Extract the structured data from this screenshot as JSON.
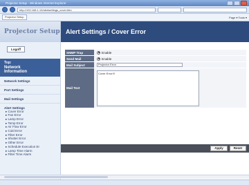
{
  "browser": {
    "title": "Projector Setup - Windows Internet Explorer",
    "address": "http://192.168.1.10/alertsettings_cover.htm",
    "address_go": "",
    "search_placeholder": "",
    "tab_label": "Projector Setup",
    "tools": "Page ▾  Tools ▾"
  },
  "sidebar": {
    "brand": "Projector Setup",
    "logout": "Logoff",
    "top_label": "Top:",
    "top_title_1": "Network",
    "top_title_2": "Information",
    "links": [
      "Network Settings",
      "Port Settings",
      "Mail Settings"
    ],
    "alert_group": "Alert Settings",
    "alert_items": [
      "Cover Error",
      "Fan Error",
      "Lamp Error",
      "Temp Error",
      "Air Flow Error",
      "Cold Error",
      "Filter Error",
      "Shutter Error",
      "Other Error",
      "Schedule Execution Er",
      "Lamp Time Alarm",
      "Filter Time Alarm"
    ]
  },
  "main": {
    "heading": "Alert Settings / Cover Error",
    "rows": {
      "snmp_label": "SNMP Trap",
      "snmp_value": "Enable",
      "send_label": "Send Mail",
      "send_value": "Enable",
      "subject_label": "Mail Subject",
      "subject_value": "Projector Error",
      "text_label": "Mail Text",
      "text_value": "Cover Error!!!"
    },
    "apply": "Apply",
    "reset": "Reset"
  }
}
